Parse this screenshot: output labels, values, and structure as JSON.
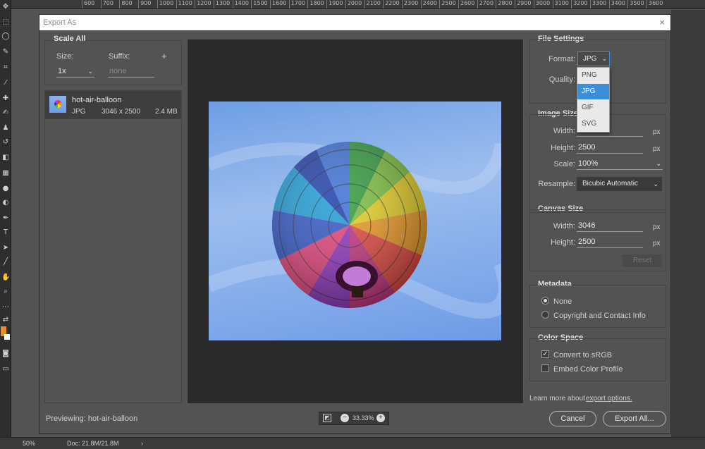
{
  "ruler_ticks": [
    "600",
    "700",
    "800",
    "900",
    "1000",
    "1100",
    "1200",
    "1300",
    "1400",
    "1500",
    "1600",
    "1700",
    "1800",
    "1900",
    "2000",
    "2100",
    "2200",
    "2300",
    "2400",
    "2500",
    "2600",
    "2700",
    "2800",
    "2900",
    "3000",
    "3100",
    "3200",
    "3300",
    "3400",
    "3500",
    "3600"
  ],
  "status": {
    "zoom": "50%",
    "doc": "Doc: 21.8M/21.8M",
    "arrow": "›"
  },
  "dialog": {
    "title": "Export As",
    "close": "×",
    "scale_all": {
      "heading": "Scale All",
      "size_label": "Size:",
      "suffix_label": "Suffix:",
      "add": "+",
      "size_value": "1x",
      "suffix_placeholder": "none"
    },
    "asset": {
      "name": "hot-air-balloon",
      "format": "JPG",
      "dimensions": "3046 x 2500",
      "filesize": "2.4 MB"
    },
    "previewing": "Previewing: hot-air-balloon",
    "zoom_value": "33.33%",
    "file_settings": {
      "heading": "File Settings",
      "format_label": "Format:",
      "format_value": "JPG",
      "quality_label": "Quality:",
      "options": [
        "PNG",
        "JPG",
        "GIF",
        "SVG"
      ],
      "selected_index": 1
    },
    "image_size": {
      "heading": "Image Size",
      "width_label": "Width:",
      "width_value": "3046",
      "height_label": "Height:",
      "height_value": "2500",
      "scale_label": "Scale:",
      "scale_value": "100%",
      "resample_label": "Resample:",
      "resample_value": "Bicubic Automatic",
      "unit": "px"
    },
    "canvas_size": {
      "heading": "Canvas Size",
      "width_label": "Width:",
      "width_value": "3046",
      "height_label": "Height:",
      "height_value": "2500",
      "unit": "px",
      "reset": "Reset"
    },
    "metadata": {
      "heading": "Metadata",
      "options": [
        "None",
        "Copyright and Contact Info"
      ],
      "selected_index": 0
    },
    "color_space": {
      "heading": "Color Space",
      "convert": "Convert to sRGB",
      "convert_checked": true,
      "embed": "Embed Color Profile",
      "embed_checked": false
    },
    "learn_more_prefix": "Learn more about ",
    "learn_more_link": "export options.",
    "cancel": "Cancel",
    "export_all": "Export All...",
    "colors": {
      "accent": "#3b8fd9",
      "dialog_bg": "#535353",
      "preview_bg": "#2a2a2a"
    }
  }
}
